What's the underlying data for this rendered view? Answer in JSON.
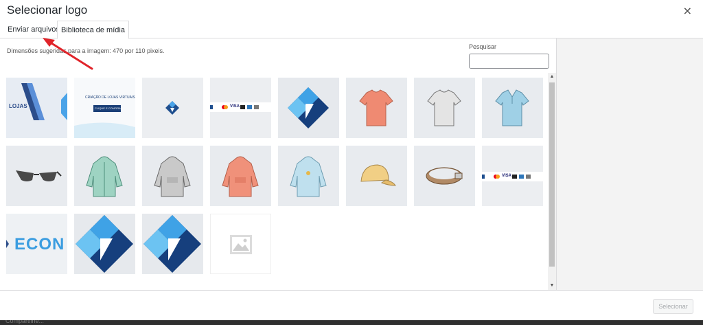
{
  "modal": {
    "title": "Selecionar logo",
    "close_symbol": "×"
  },
  "tabs": [
    {
      "label": "Enviar arquivos"
    },
    {
      "label": "Biblioteca de mídia"
    }
  ],
  "hint": "Dimensões sugeridas para a imagem: 470 por 110 pixeis.",
  "search": {
    "label": "Pesquisar",
    "value": ""
  },
  "footer": {
    "select_label": "Selecionar"
  },
  "media_items": [
    {
      "icon": "logo-lojas-partial"
    },
    {
      "icon": "banner-criacao-lojas-virtuais",
      "heading": "CRIAÇÃO DE LOJAS VIRTUAIS",
      "button": "CLIQUE E CONFIRA"
    },
    {
      "icon": "small-blue-diamond-logo"
    },
    {
      "icon": "payment-cards-strip",
      "text": "VISA"
    },
    {
      "icon": "blue-diamond-logo"
    },
    {
      "icon": "salmon-tshirt"
    },
    {
      "icon": "gray-tshirt"
    },
    {
      "icon": "blue-polo-shirt"
    },
    {
      "icon": "sunglasses"
    },
    {
      "icon": "green-hoodie"
    },
    {
      "icon": "gray-hoodie"
    },
    {
      "icon": "salmon-hoodie"
    },
    {
      "icon": "light-blue-hoodie"
    },
    {
      "icon": "yellow-cap"
    },
    {
      "icon": "brown-belt"
    },
    {
      "icon": "payment-cards-strip",
      "text": "VISA"
    },
    {
      "icon": "econ-text-logo",
      "text": "ECON"
    },
    {
      "icon": "large-blue-diamond-logo"
    },
    {
      "icon": "large-blue-diamond-logo"
    },
    {
      "icon": "image-placeholder"
    }
  ],
  "background": {
    "ghost_text": "Compartilhe..."
  },
  "colors": {
    "accent_red": "#e0242a",
    "brand_blue": "#1a5a9c"
  }
}
